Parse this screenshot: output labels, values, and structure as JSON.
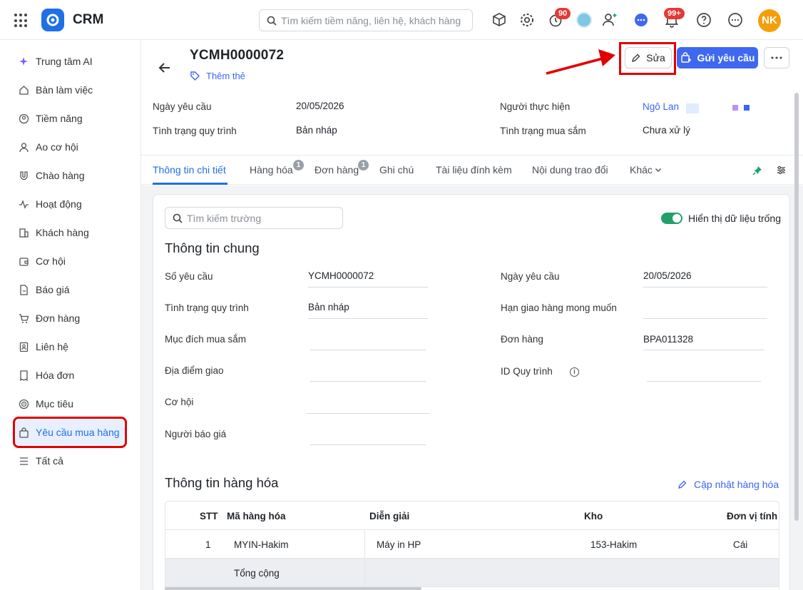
{
  "app": {
    "name": "CRM"
  },
  "topbar": {
    "search_placeholder": "Tìm kiếm tiềm năng, liên hệ, khách hàng",
    "badges": {
      "timer": "90",
      "notifications": "99+"
    },
    "user_initials": "NK",
    "icons": [
      "box-search-icon",
      "gear-icon",
      "timer-icon",
      "avatar",
      "add-user-icon",
      "chat-icon",
      "bell-icon",
      "help-icon",
      "more-icon"
    ]
  },
  "sidebar": {
    "items": [
      {
        "label": "Trung tâm AI",
        "icon": "sparkle-icon"
      },
      {
        "label": "Bàn làm việc",
        "icon": "home-icon"
      },
      {
        "label": "Tiềm năng",
        "icon": "lead-icon"
      },
      {
        "label": "Ao cơ hội",
        "icon": "pool-icon"
      },
      {
        "label": "Chào hàng",
        "icon": "magnet-icon"
      },
      {
        "label": "Hoạt động",
        "icon": "activity-icon"
      },
      {
        "label": "Khách hàng",
        "icon": "building-icon"
      },
      {
        "label": "Cơ hội",
        "icon": "wallet-icon"
      },
      {
        "label": "Báo giá",
        "icon": "quote-icon"
      },
      {
        "label": "Đơn hàng",
        "icon": "cart-icon"
      },
      {
        "label": "Liên hệ",
        "icon": "contact-icon"
      },
      {
        "label": "Hóa đơn",
        "icon": "invoice-icon"
      },
      {
        "label": "Mục tiêu",
        "icon": "target-icon"
      },
      {
        "label": "Yêu cầu mua hàng",
        "icon": "bag-icon",
        "active": true
      },
      {
        "label": "Tất cả",
        "icon": "menu-icon"
      }
    ]
  },
  "record": {
    "title": "YCMH0000072",
    "add_tag": "Thêm thẻ",
    "edit_label": "Sửa",
    "send_label": "Gửi yêu cầu",
    "header_fields": {
      "request_date_label": "Ngày yêu cầu",
      "request_date": "20/05/2026",
      "process_status_label": "Tình trạng quy trình",
      "process_status": "Bản nháp",
      "assignee_label": "Người thực hiện",
      "assignee": "Ngô Lan",
      "purchase_status_label": "Tình trạng mua sắm",
      "purchase_status": "Chưa xử lý"
    }
  },
  "tabs": [
    {
      "label": "Thông tin chi tiết",
      "active": true
    },
    {
      "label": "Hàng hóa",
      "badge": "1"
    },
    {
      "label": "Đơn hàng",
      "badge": "1"
    },
    {
      "label": "Ghi chú"
    },
    {
      "label": "Tài liệu đính kèm"
    },
    {
      "label": "Nội dung trao đổi"
    },
    {
      "label": "Khác"
    }
  ],
  "detail": {
    "field_search_placeholder": "Tìm kiếm trường",
    "show_empty_label": "Hiển thị dữ liệu trống",
    "general_title": "Thông tin chung",
    "fields": {
      "request_no_label": "Số yêu cầu",
      "request_no": "YCMH0000072",
      "process_status_label": "Tình trạng quy trình",
      "process_status": "Bản nháp",
      "purpose_label": "Mục đích mua sắm",
      "delivery_place_label": "Địa điểm giao",
      "opportunity_label": "Cơ hội",
      "quoter_label": "Người báo giá",
      "request_date_label": "Ngày yêu cầu",
      "request_date": "20/05/2026",
      "desired_delivery_label": "Hạn giao hàng mong muốn",
      "order_label": "Đơn hàng",
      "order": "BPA011328",
      "process_id_label": "ID Quy trình",
      "process_id_info": "i"
    },
    "goods_title": "Thông tin hàng hóa",
    "update_goods_label": "Cập nhật hàng hóa",
    "table": {
      "headers": [
        "STT",
        "Mã hàng hóa",
        "Diễn giải",
        "Kho",
        "Đơn vị tính"
      ],
      "rows": [
        [
          "1",
          "MYIN-Hakim",
          "Máy in HP",
          "153-Hakim",
          "Cái"
        ]
      ],
      "total_label": "Tổng cộng"
    }
  }
}
